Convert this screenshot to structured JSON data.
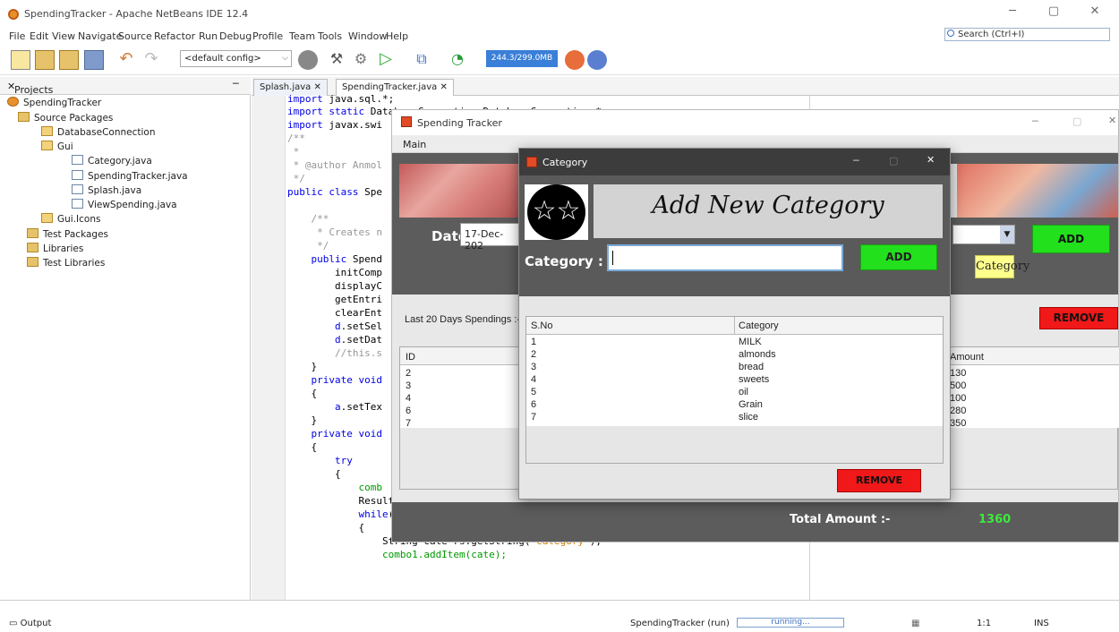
{
  "window": {
    "title": "SpendingTracker - Apache NetBeans IDE 12.4"
  },
  "menu": [
    "File",
    "Edit",
    "View",
    "Navigate",
    "Source",
    "Refactor",
    "Run",
    "Debug",
    "Profile",
    "Team",
    "Tools",
    "Window",
    "Help"
  ],
  "search": {
    "placeholder": "Search (Ctrl+I)"
  },
  "toolbar": {
    "config": "<default config>",
    "memory": "244.3/299.0MB"
  },
  "projects": {
    "header": "Projects",
    "items": [
      "SpendingTracker",
      "Source Packages",
      "DatabaseConnection",
      "Gui",
      "Category.java",
      "SpendingTracker.java",
      "Splash.java",
      "ViewSpending.java",
      "Gui.Icons",
      "Test Packages",
      "Libraries",
      "Test Libraries"
    ]
  },
  "editor": {
    "tabs": [
      "Splash.java",
      "SpendingTracker.java"
    ],
    "lines": [
      "import java.sql.*;",
      "import static DatabaseConnection.DatabaseConnection.*;",
      "import javax.swi",
      "/**",
      " *",
      " * @author Anmol",
      " */",
      "public class Spe",
      "",
      "    /**",
      "     * Creates n",
      "     */",
      "    public Spend",
      "        initComp",
      "        displayC",
      "        getEntri",
      "        clearEnt",
      "        d.setSel",
      "        d.setDat",
      "        //this.s",
      "    }",
      "    private void",
      "    {",
      "        a.setTex",
      "    }",
      "    private void",
      "    {",
      "        try",
      "        {",
      "            comb",
      "            ResultSet rs=st.executeQuery(\"select * from category\");",
      "            while(rs.next())",
      "            {",
      "                String cate=rs.getString(\"category\");",
      "                combo1.addItem(cate);"
    ]
  },
  "status": {
    "output": "Output",
    "run": "SpendingTracker (run)",
    "progress": "running...",
    "pos": "1:1",
    "mode": "INS"
  },
  "spending": {
    "title": "Spending Tracker",
    "menu": "Main",
    "date_label": "Date :",
    "date_value": "17-Dec-202",
    "add": "ADD",
    "category_btn": "Category",
    "last20": "Last 20 Days Spendings :-",
    "remove": "REMOVE",
    "id_header": "ID",
    "amount_header": "Amount",
    "ids": [
      "2",
      "3",
      "4",
      "6",
      "7"
    ],
    "amounts": [
      "130",
      "500",
      "100",
      "280",
      "350"
    ],
    "total_label": "Total Amount :-",
    "total_value": "1360"
  },
  "category": {
    "title": "Category",
    "banner_title": "Add New Category",
    "label": "Category :",
    "input_value": "",
    "add": "ADD",
    "col_sno": "S.No",
    "col_cat": "Category",
    "rows": [
      {
        "sno": "1",
        "cat": "MILK"
      },
      {
        "sno": "2",
        "cat": "almonds"
      },
      {
        "sno": "3",
        "cat": "bread"
      },
      {
        "sno": "4",
        "cat": "sweets"
      },
      {
        "sno": "5",
        "cat": "oil"
      },
      {
        "sno": "6",
        "cat": "Grain"
      },
      {
        "sno": "7",
        "cat": "slice"
      }
    ],
    "remove": "REMOVE"
  },
  "colors": {
    "add_green": "#22e01c",
    "remove_red": "#f01818",
    "total_green": "#3ee83e",
    "dialog_dark": "#5a5a5a"
  }
}
